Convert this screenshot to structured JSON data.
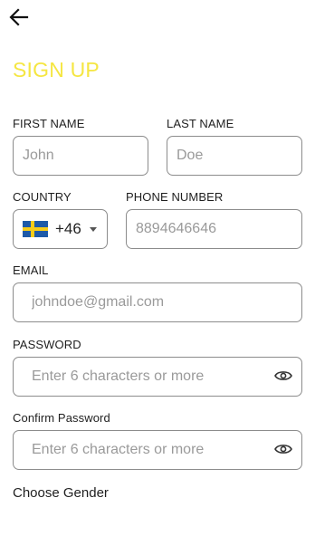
{
  "colors": {
    "title": "#f5e642",
    "border": "#8c8c8c",
    "placeholder": "#9a9a9a"
  },
  "header": {
    "back_icon": "arrow-left-icon"
  },
  "title": "SIGN UP",
  "first_name": {
    "label": "FIRST NAME",
    "placeholder": "John"
  },
  "last_name": {
    "label": "LAST NAME",
    "placeholder": "Doe"
  },
  "country": {
    "label": "COUNTRY",
    "flag": "sweden-flag-icon",
    "dial_code": "+46"
  },
  "phone": {
    "label": "PHONE NUMBER",
    "placeholder": "8894646646"
  },
  "email": {
    "label": "EMAIL",
    "placeholder": "johndoe@gmail.com"
  },
  "password": {
    "label": "PASSWORD",
    "placeholder": "Enter 6 characters or more",
    "toggle_icon": "eye-icon"
  },
  "confirm_password": {
    "label": "Confirm Password",
    "placeholder": "Enter 6 characters or more",
    "toggle_icon": "eye-icon"
  },
  "gender": {
    "label": "Choose Gender"
  }
}
